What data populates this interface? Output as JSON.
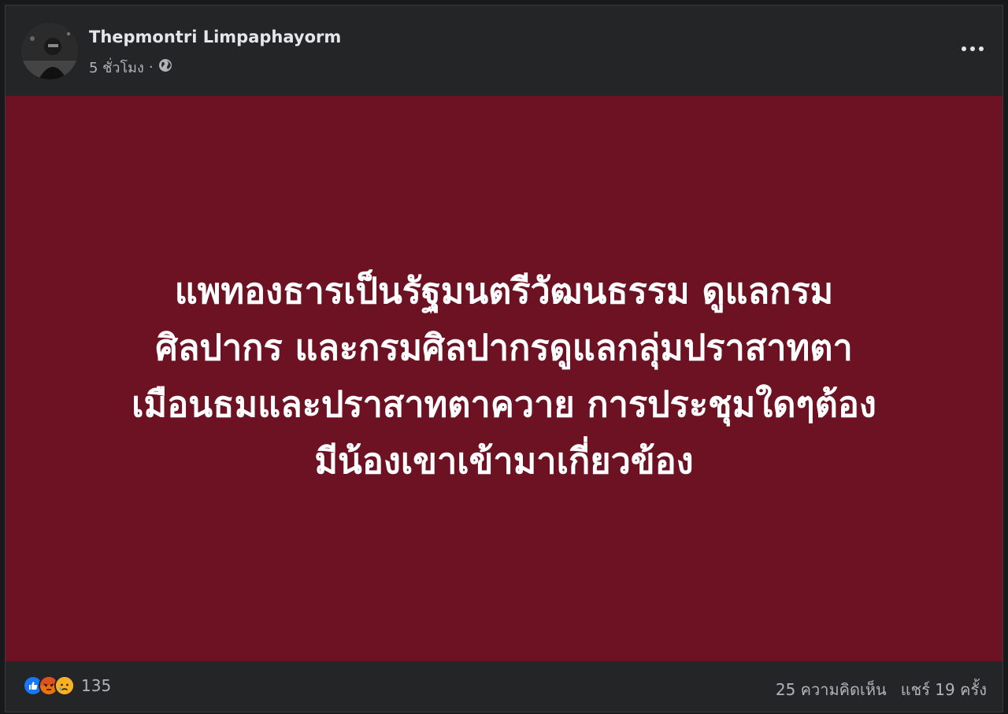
{
  "post": {
    "author": "Thepmontri Limpaphayorm",
    "time": "5 ชั่วโมง",
    "separator": "·",
    "privacy_icon": "globe-icon",
    "more_icon": "more-options-icon",
    "background_color": "#6d1223",
    "text_lines": [
      "แพทองธารเป็นรัฐมนตรีวัฒนธรรม ดูแลกรม",
      "ศิลปากร และกรมศิลปากรดูแลกลุ่มปราสาทตา",
      "เมือนธมและปราสาทตาควาย การประชุมใดๆต้อง",
      "มีน้องเขาเข้ามาเกี่ยวข้อง"
    ]
  },
  "footer": {
    "reactions": [
      "like-icon",
      "angry-icon",
      "sad-icon"
    ],
    "reaction_count": "135",
    "comments": "25 ความคิดเห็น",
    "shares": "แชร์ 19 ครั้ง"
  },
  "colors": {
    "like": "#1877f2",
    "angry": "#e9710f",
    "sad": "#f7b125"
  }
}
